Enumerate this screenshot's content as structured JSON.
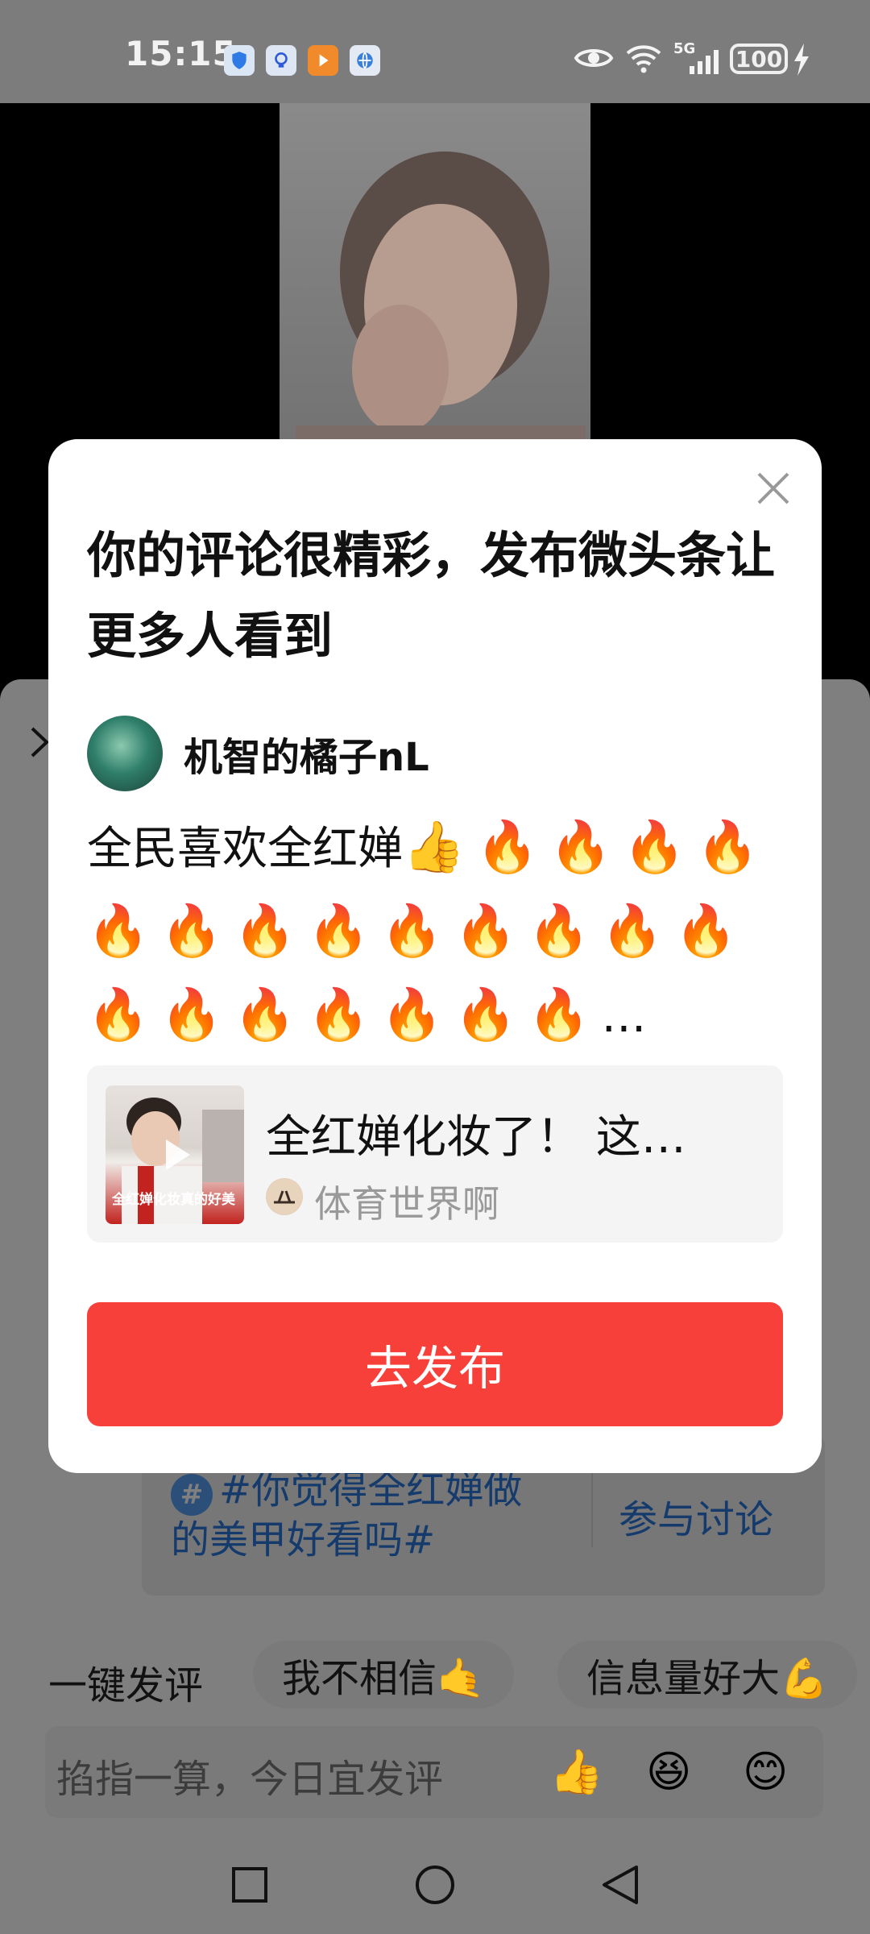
{
  "status_bar": {
    "time": "15:15",
    "network": "5G",
    "battery": "100",
    "app_icons": [
      "shield-app-icon",
      "bulb-app-icon",
      "video-app-icon",
      "browser-app-icon"
    ]
  },
  "dialog": {
    "title": "你的评论很精彩，发布微头条让更多人看到",
    "username": "机智的橘子nL",
    "comment_text": "全民喜欢全红婵",
    "comment_emojis": [
      "👍",
      "🔥",
      "🔥",
      "🔥",
      "🔥",
      "🔥",
      "🔥",
      "🔥",
      "🔥",
      "🔥",
      "🔥",
      "🔥",
      "🔥",
      "🔥",
      "🔥",
      "🔥",
      "🔥",
      "🔥",
      "🔥",
      "🔥",
      "🔥"
    ],
    "comment_ellipsis": "…",
    "post": {
      "title": "全红婵化妆了！ 这…",
      "author": "体育世界啊",
      "thumb_caption": "全红婵化妆真的好美"
    },
    "publish_label": "去发布"
  },
  "background": {
    "topic": "#你觉得全红婵做的美甲好看吗#",
    "join_label": "参与讨论",
    "quick_comment_label": "一键发评",
    "chips": [
      "我不相信🤙",
      "信息量好大💪"
    ],
    "input_placeholder": "掐指一算，今日宜发评",
    "quick_emojis": [
      "👍",
      "😆",
      "😊"
    ]
  },
  "colors": {
    "accent_red": "#f8403a",
    "topic_blue": "#153a6c",
    "overlay_gray": "#7f7f7f"
  }
}
